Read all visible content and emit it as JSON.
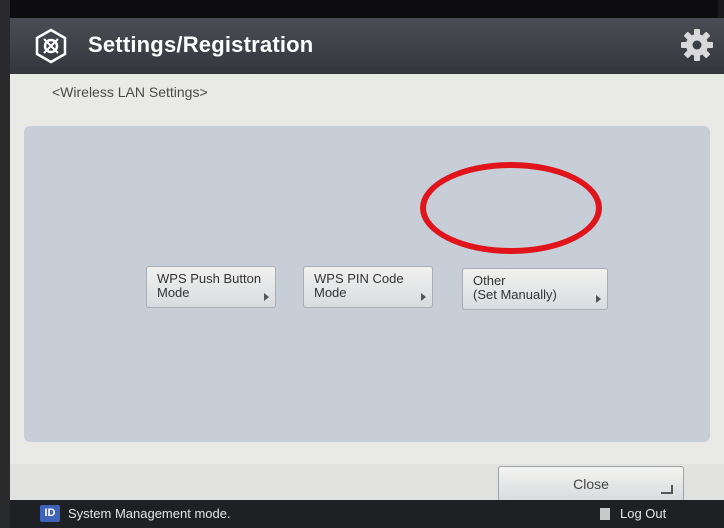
{
  "header": {
    "title": "Settings/Registration",
    "app_icon": "settings-registration-icon",
    "gear_icon": "gear-icon"
  },
  "breadcrumb": "<Wireless LAN Settings>",
  "options": [
    {
      "label": "WPS Push Button\nMode"
    },
    {
      "label": "WPS PIN Code\nMode"
    },
    {
      "label": "Other\n(Set Manually)"
    }
  ],
  "close_button": {
    "label": "Close"
  },
  "status": {
    "badge": "ID",
    "text": "System Management mode.",
    "logout_label": "Log Out"
  },
  "colors": {
    "annotation": "#e0141a",
    "titlebar": "#3e4047",
    "content_bg": "#c7ced7"
  }
}
